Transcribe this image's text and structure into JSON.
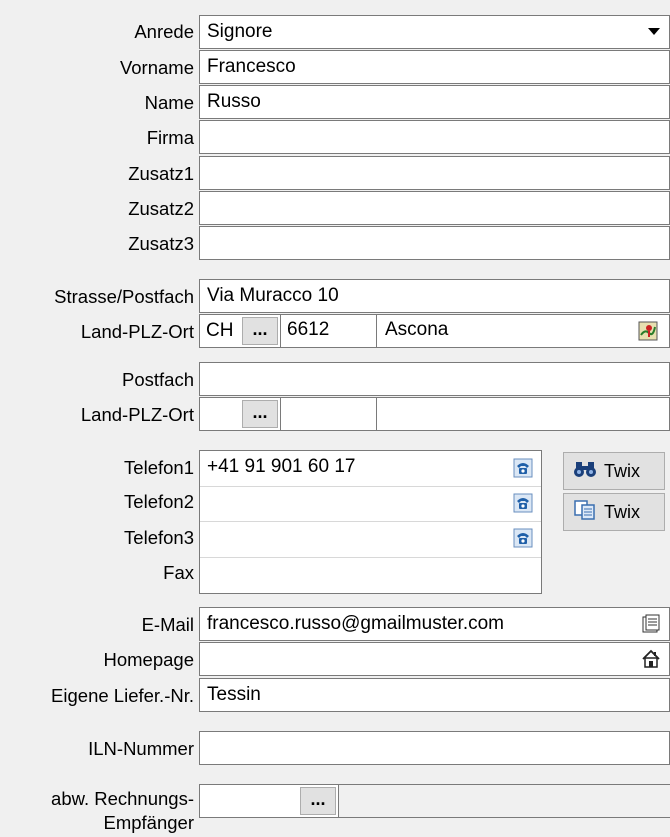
{
  "labels": {
    "anrede": "Anrede",
    "vorname": "Vorname",
    "name": "Name",
    "firma": "Firma",
    "zusatz1": "Zusatz1",
    "zusatz2": "Zusatz2",
    "zusatz3": "Zusatz3",
    "strasse": "Strasse/Postfach",
    "land_plz_ort": "Land-PLZ-Ort",
    "postfach": "Postfach",
    "land_plz_ort_2": "Land-PLZ-Ort",
    "telefon1": "Telefon1",
    "telefon2": "Telefon2",
    "telefon3": "Telefon3",
    "fax": "Fax",
    "email": "E-Mail",
    "homepage": "Homepage",
    "liefer_nr": "Eigene Liefer.-Nr.",
    "iln": "ILN-Nummer",
    "abw_line1": "abw. Rechnungs-",
    "abw_line2": "Empfänger"
  },
  "values": {
    "anrede": "Signore",
    "vorname": "Francesco",
    "name": "Russo",
    "firma": "",
    "zusatz1": "",
    "zusatz2": "",
    "zusatz3": "",
    "strasse": "Via Muracco 10",
    "land": "CH",
    "plz": "6612",
    "ort": "Ascona",
    "postfach": "",
    "land2": "",
    "plz2": "",
    "ort2": "",
    "telefon1": "+41 91 901 60 17",
    "telefon2": "",
    "telefon3": "",
    "fax": "",
    "email": "francesco.russo@gmailmuster.com",
    "homepage": "",
    "liefer_nr": "Tessin",
    "iln": "",
    "abw": ""
  },
  "buttons": {
    "dots": "...",
    "twix_search": "Twix",
    "twix_copy": "Twix"
  },
  "icons": {
    "dropdown": "chevron-down-icon",
    "map": "map-icon",
    "phone": "phone-icon",
    "binoculars": "binoculars-icon",
    "copy": "copy-icon",
    "email": "email-icon",
    "home": "home-icon"
  }
}
